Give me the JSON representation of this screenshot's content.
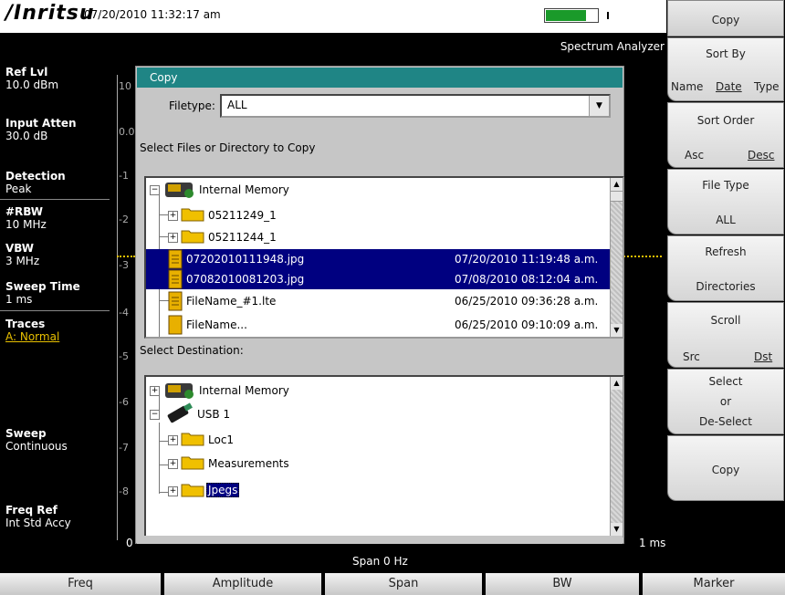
{
  "header": {
    "logo": "/Inritsu",
    "datetime": "07/20/2010 11:32:17 am",
    "mode": "Spectrum Analyzer",
    "battery_level": 0.75,
    "battery_color": "#1a9a2a"
  },
  "left_panel": {
    "ref_lvl_title": "Ref Lvl",
    "ref_lvl_value": "10.0 dBm",
    "input_atten_title": "Input Atten",
    "input_atten_value": "30.0 dB",
    "detection_title": "Detection",
    "detection_value": "Peak",
    "rbw_title": "#RBW",
    "rbw_value": "10 MHz",
    "vbw_title": "VBW",
    "vbw_value": "3 MHz",
    "sweep_time_title": "Sweep Time",
    "sweep_time_value": "1 ms",
    "traces_title": "Traces",
    "traces_value": "A: Normal",
    "sweep_title": "Sweep",
    "sweep_value": "Continuous",
    "freq_ref_title": "Freq Ref",
    "freq_ref_value": "Int Std Accy"
  },
  "graph": {
    "grid_labels": [
      "10",
      "0.0",
      "-1",
      "-2",
      "-3",
      "-4",
      "-5",
      "-6",
      "-7",
      "-8"
    ],
    "x_start": "0",
    "x_end": "1 ms",
    "span_label": "Span 0 Hz"
  },
  "dialog": {
    "title": "Copy",
    "filetype_label": "Filetype:",
    "filetype_value": "ALL",
    "source_label": "Select Files or Directory to Copy",
    "dest_label": "Select Destination:",
    "source_items": [
      {
        "name": "Internal Memory",
        "date": ""
      },
      {
        "name": "05211249_1",
        "date": ""
      },
      {
        "name": "05211244_1",
        "date": ""
      },
      {
        "name": "07202010111948.jpg",
        "date": "07/20/2010 11:19:48 a.m."
      },
      {
        "name": "07082010081203.jpg",
        "date": "07/08/2010 08:12:04 a.m."
      },
      {
        "name": "FileName_#1.lte",
        "date": "06/25/2010 09:36:28 a.m."
      },
      {
        "name": "FileName...",
        "date": "06/25/2010 09:10:09 a.m."
      }
    ],
    "dest_items": [
      {
        "name": "Internal Memory"
      },
      {
        "name": "USB 1"
      },
      {
        "name": "Loc1"
      },
      {
        "name": "Measurements"
      },
      {
        "name": "Jpegs"
      }
    ]
  },
  "right_menu": {
    "title": "Copy",
    "sort_by_title": "Sort By",
    "sort_by_opt1": "Name",
    "sort_by_opt2": "Date",
    "sort_by_opt3": "Type",
    "sort_order_title": "Sort Order",
    "sort_order_opt1": "Asc",
    "sort_order_opt2": "Desc",
    "file_type_title": "File Type",
    "file_type_value": "ALL",
    "refresh_line1": "Refresh",
    "refresh_line2": "Directories",
    "scroll_title": "Scroll",
    "scroll_opt1": "Src",
    "scroll_opt2": "Dst",
    "select_line1": "Select",
    "select_line2": "or",
    "select_line3": "De-Select",
    "copy_label": "Copy"
  },
  "bottom_keys": [
    "Freq",
    "Amplitude",
    "Span",
    "BW",
    "Marker"
  ],
  "colors": {
    "title_bar": "#1f8585",
    "selection": "#000080",
    "trace": "#e8c000"
  }
}
